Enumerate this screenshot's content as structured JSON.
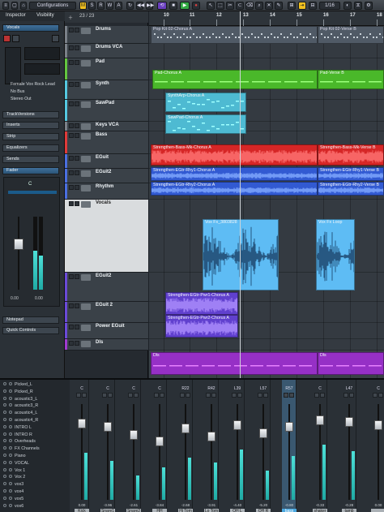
{
  "toolbar": {
    "configurations_label": "Configurations",
    "mode_buttons": [
      "M",
      "S",
      "R",
      "W",
      "A"
    ],
    "quantize_label": "1/16"
  },
  "inspector": {
    "tabs": [
      "Inspector",
      "Visibility"
    ],
    "track_name": "Vocals",
    "preset": "Female Vox Rock Lead",
    "input": "No Bus",
    "output": "Stereo Out",
    "sections": [
      "TrackVersions",
      "Inserts",
      "Strip",
      "Equalizers",
      "Sends",
      "Fader"
    ],
    "fader_pan": "C",
    "fader_values": [
      "0.00",
      "0.00"
    ],
    "bottom_sections": [
      "Notepad",
      "Quick Controls"
    ]
  },
  "tracklist": {
    "counter": "23 / 23",
    "tracks": [
      {
        "name": "Drums",
        "color": "#7a8088"
      },
      {
        "name": "Drums VCA",
        "color": "#7a8088"
      },
      {
        "name": "Pad",
        "color": "#63c640"
      },
      {
        "name": "Synth",
        "color": "#55c8e0"
      },
      {
        "name": "SawPad",
        "color": "#55c8e0"
      },
      {
        "name": "Keys VCA",
        "color": "#7a8088"
      },
      {
        "name": "Bass",
        "color": "#e03a3a"
      },
      {
        "name": "EGuit",
        "color": "#4a6fe0"
      },
      {
        "name": "EGuit2",
        "color": "#4a6fe0"
      },
      {
        "name": "Rhythm",
        "color": "#4a6fe0"
      },
      {
        "name": "Vocals",
        "color": "#d9dcde"
      },
      {
        "name": "EGuit2",
        "color": "#6a4ad8"
      },
      {
        "name": "EGuit 2",
        "color": "#6a4ad8"
      },
      {
        "name": "Power EGuit",
        "color": "#6a4ad8"
      },
      {
        "name": "Dls",
        "color": "#a03ad0"
      }
    ]
  },
  "ruler": {
    "bars": [
      "10",
      "11",
      "12",
      "13",
      "14",
      "15",
      "16",
      "17",
      "18"
    ]
  },
  "parts": [
    {
      "label": "Pop Kit 02-Chorus A",
      "color": "#5a6470"
    },
    {
      "label": "Pop Kit 02-Verse B",
      "color": "#5a6470"
    },
    {
      "label": "Pad-Chorus A",
      "color": "#54c234"
    },
    {
      "label": "Pad-Verse B",
      "color": "#54c234"
    },
    {
      "label": "SynthArp-Chorus A",
      "color": "#58c4dc"
    },
    {
      "label": "SawPad-Chorus A",
      "color": "#58c4dc"
    },
    {
      "label": "Strengthen-Bass-Mk-Chorus A",
      "color": "#e03030"
    },
    {
      "label": "Strengthen-Bass-Mk-Verse B",
      "color": "#e03030"
    },
    {
      "label": "Strengthen-EGtr-Rhy1-Chorus A",
      "color": "#3c64dc"
    },
    {
      "label": "Strengthen-EGtr-Rhy1-Verse B",
      "color": "#3c64dc"
    },
    {
      "label": "Strengthen-EGtr-Rhy2-Chorus A",
      "color": "#3c64dc"
    },
    {
      "label": "Strengthen-EGtr-Rhy2-Verse B",
      "color": "#3c64dc"
    },
    {
      "label": "Vox Fx_3803828",
      "color": "#4aa8e0"
    },
    {
      "label": "Vox Fx Loop",
      "color": "#4aa8e0"
    },
    {
      "label": "Strengthen-EGtr-Pwr1-Chorus A",
      "color": "#6a4ad8"
    },
    {
      "label": "Strengthen-EGtr-Pwr2-Chorus A",
      "color": "#6a4ad8"
    },
    {
      "label": "Dls",
      "color": "#a03ad0"
    },
    {
      "label": "Dls",
      "color": "#a03ad0"
    }
  ],
  "mixer_list": {
    "items": [
      "Picked_L",
      "Picked_R",
      "acoustic3_L",
      "acoustic3_R",
      "acoustic4_L",
      "acoustic4_R",
      "INTRO L",
      "INTRO R",
      "Overheads",
      "FX Channels",
      "Piano",
      "VOCAL",
      "Vox 1",
      "Vox 2",
      "vox3",
      "vox4",
      "vox5",
      "vox6"
    ]
  },
  "mixer": {
    "channels": [
      {
        "name": "Kick",
        "pan": "C",
        "value": "0.00"
      },
      {
        "name": "Snare1",
        "pan": "C",
        "value": "-3.96"
      },
      {
        "name": "Snare2",
        "pan": "C",
        "value": "-2.61"
      },
      {
        "name": "HH",
        "pan": "C",
        "value": "-3.84"
      },
      {
        "name": "Hi Tom",
        "pan": "R22",
        "value": "-2.68"
      },
      {
        "name": "Lo Tom",
        "pan": "R42",
        "value": "-3.91"
      },
      {
        "name": "OH L",
        "pan": "L39",
        "value": "-4.40"
      },
      {
        "name": "OH R",
        "pan": "L57",
        "value": "-5.20"
      },
      {
        "name": "bass",
        "pan": "R57",
        "value": "-0.80"
      },
      {
        "name": "shaker",
        "pan": "C",
        "value": "-0.33"
      },
      {
        "name": "tamb",
        "pan": "L47",
        "value": "-0.28"
      },
      {
        "name": "",
        "pan": "C",
        "value": "0.00"
      }
    ]
  }
}
